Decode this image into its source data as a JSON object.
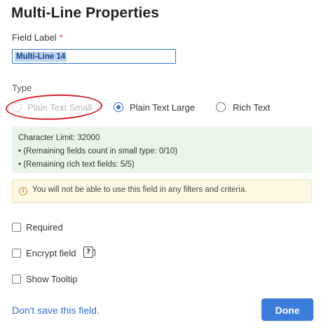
{
  "dialog": {
    "title": "Multi-Line Properties",
    "field_label": {
      "label": "Field Label",
      "required_marker": "*",
      "value": "Multi-Line 14"
    },
    "type": {
      "label": "Type",
      "options": [
        {
          "label": "Plain Text Small",
          "checked": false,
          "disabled": true
        },
        {
          "label": "Plain Text Large",
          "checked": true,
          "disabled": false
        },
        {
          "label": "Rich Text",
          "checked": false,
          "disabled": false
        }
      ]
    },
    "info": {
      "character_limit": "Character Limit: 32000",
      "small_remaining": "• (Remaining fields count in small type: 0/10)",
      "rich_remaining": "• (Remaining rich text fields: 5/5)"
    },
    "warning": {
      "icon": "info-icon",
      "text": "You will not be able to use this field in any filters and criteria."
    },
    "checkboxes": [
      {
        "label": "Required",
        "checked": false
      },
      {
        "label": "Encrypt field",
        "checked": false,
        "icon": "help-icon"
      },
      {
        "label": "Show Tooltip",
        "checked": false
      }
    ],
    "footer": {
      "dont_save_label": "Don't save this field.",
      "done_label": "Done"
    }
  },
  "colors": {
    "accent": "#3c7ddb",
    "link": "#2d6fd1",
    "annotation": "#d51f2a",
    "success_bg": "#e9f5e8",
    "warning_bg": "#fcf8e3"
  }
}
